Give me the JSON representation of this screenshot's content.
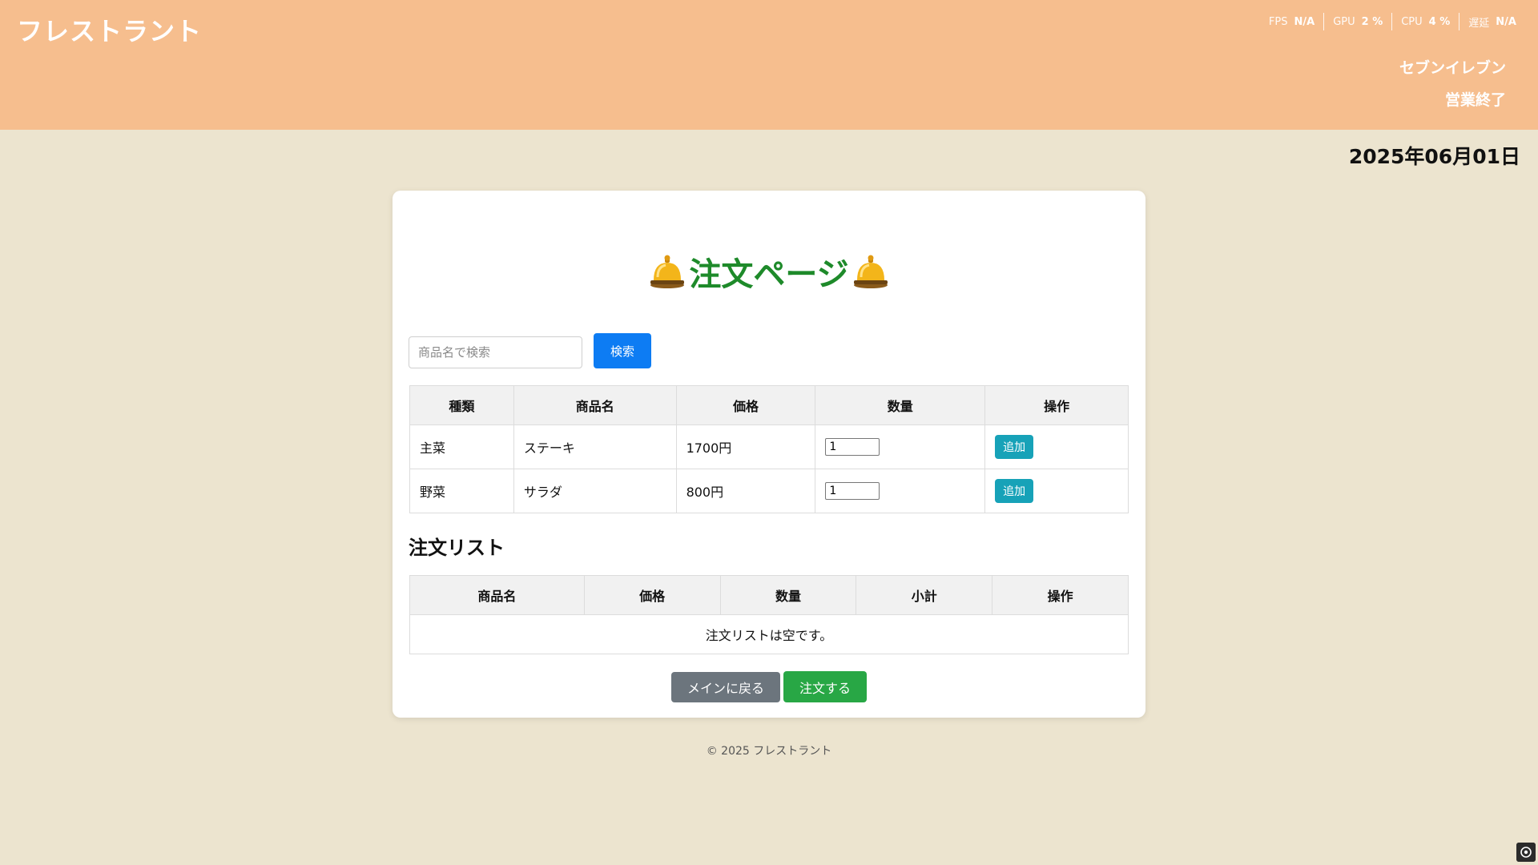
{
  "header": {
    "app_title": "フレストラント",
    "stats": [
      {
        "label": "FPS",
        "value": "N/A"
      },
      {
        "label": "GPU",
        "value": "2 %"
      },
      {
        "label": "CPU",
        "value": "4 %"
      },
      {
        "label": "遅延",
        "value": "N/A"
      }
    ],
    "store_name": "セブンイレブン",
    "store_status": "営業終了",
    "date": "2025年06月01日"
  },
  "main": {
    "title": "注文ページ",
    "title_icon": "bell-icon",
    "search": {
      "placeholder": "商品名で検索",
      "value": "",
      "button_label": "検索"
    },
    "menu_table": {
      "headers": [
        "種類",
        "商品名",
        "価格",
        "数量",
        "操作"
      ],
      "rows": [
        {
          "category": "主菜",
          "name": "ステーキ",
          "price": "1700円",
          "quantity": "1",
          "action": "追加"
        },
        {
          "category": "野菜",
          "name": "サラダ",
          "price": "800円",
          "quantity": "1",
          "action": "追加"
        }
      ]
    },
    "order_list": {
      "heading": "注文リスト",
      "headers": [
        "商品名",
        "価格",
        "数量",
        "小計",
        "操作"
      ],
      "empty_message": "注文リストは空です。"
    },
    "buttons": {
      "back": "メインに戻る",
      "order": "注文する"
    }
  },
  "footer": {
    "text": "© 2025 フレストラント"
  },
  "colors": {
    "header_bg": "#f6be8e",
    "page_bg": "#ece4cf",
    "title_green": "#1e8a2a",
    "search_blue": "#0d7cf3",
    "add_teal": "#17a2b8",
    "back_gray": "#6c757d",
    "order_green": "#28a745"
  }
}
